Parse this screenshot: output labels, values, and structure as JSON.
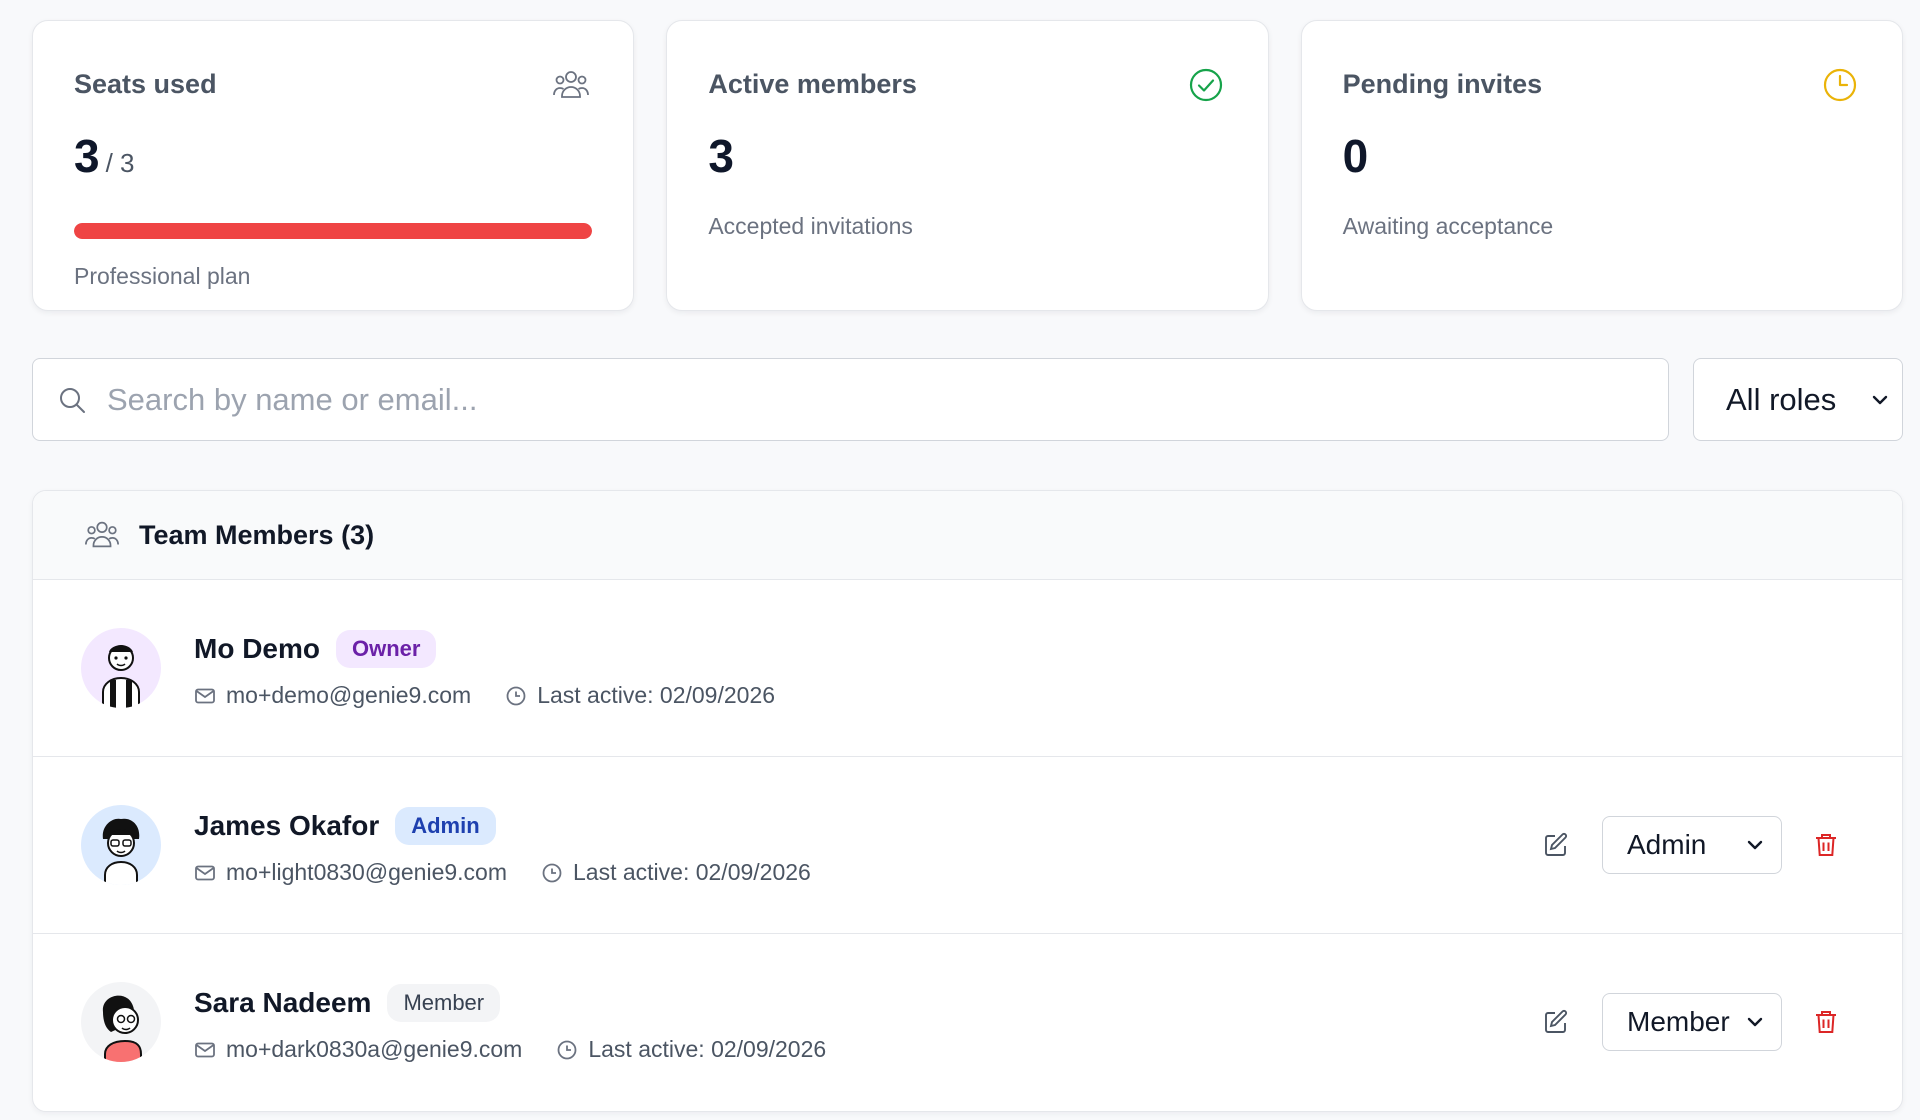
{
  "stats": {
    "seats": {
      "title": "Seats used",
      "used": "3",
      "total": "/ 3",
      "usage_fraction": 1.0,
      "bar_color": "#ef4444",
      "plan": "Professional plan",
      "icon": "users-icon"
    },
    "active": {
      "title": "Active members",
      "value": "3",
      "caption": "Accepted invitations",
      "icon": "check-circle-icon",
      "icon_color": "#16a34a"
    },
    "pending": {
      "title": "Pending invites",
      "value": "0",
      "caption": "Awaiting acceptance",
      "icon": "clock-icon",
      "icon_color": "#eab308"
    }
  },
  "search": {
    "placeholder": "Search by name or email...",
    "value": ""
  },
  "role_filter": {
    "selected": "All roles"
  },
  "team": {
    "title": "Team Members (3)",
    "members": [
      {
        "name": "Mo Demo",
        "role_badge": "Owner",
        "email": "mo+demo@genie9.com",
        "last_active": "Last active: 02/09/2026",
        "editable": false
      },
      {
        "name": "James Okafor",
        "role_badge": "Admin",
        "email": "mo+light0830@genie9.com",
        "last_active": "Last active: 02/09/2026",
        "editable": true,
        "role_select": "Admin"
      },
      {
        "name": "Sara Nadeem",
        "role_badge": "Member",
        "email": "mo+dark0830a@genie9.com",
        "last_active": "Last active: 02/09/2026",
        "editable": true,
        "role_select": "Member"
      }
    ]
  },
  "colors": {
    "danger": "#dc2626",
    "muted": "#6b7280",
    "border": "#e5e7eb"
  }
}
